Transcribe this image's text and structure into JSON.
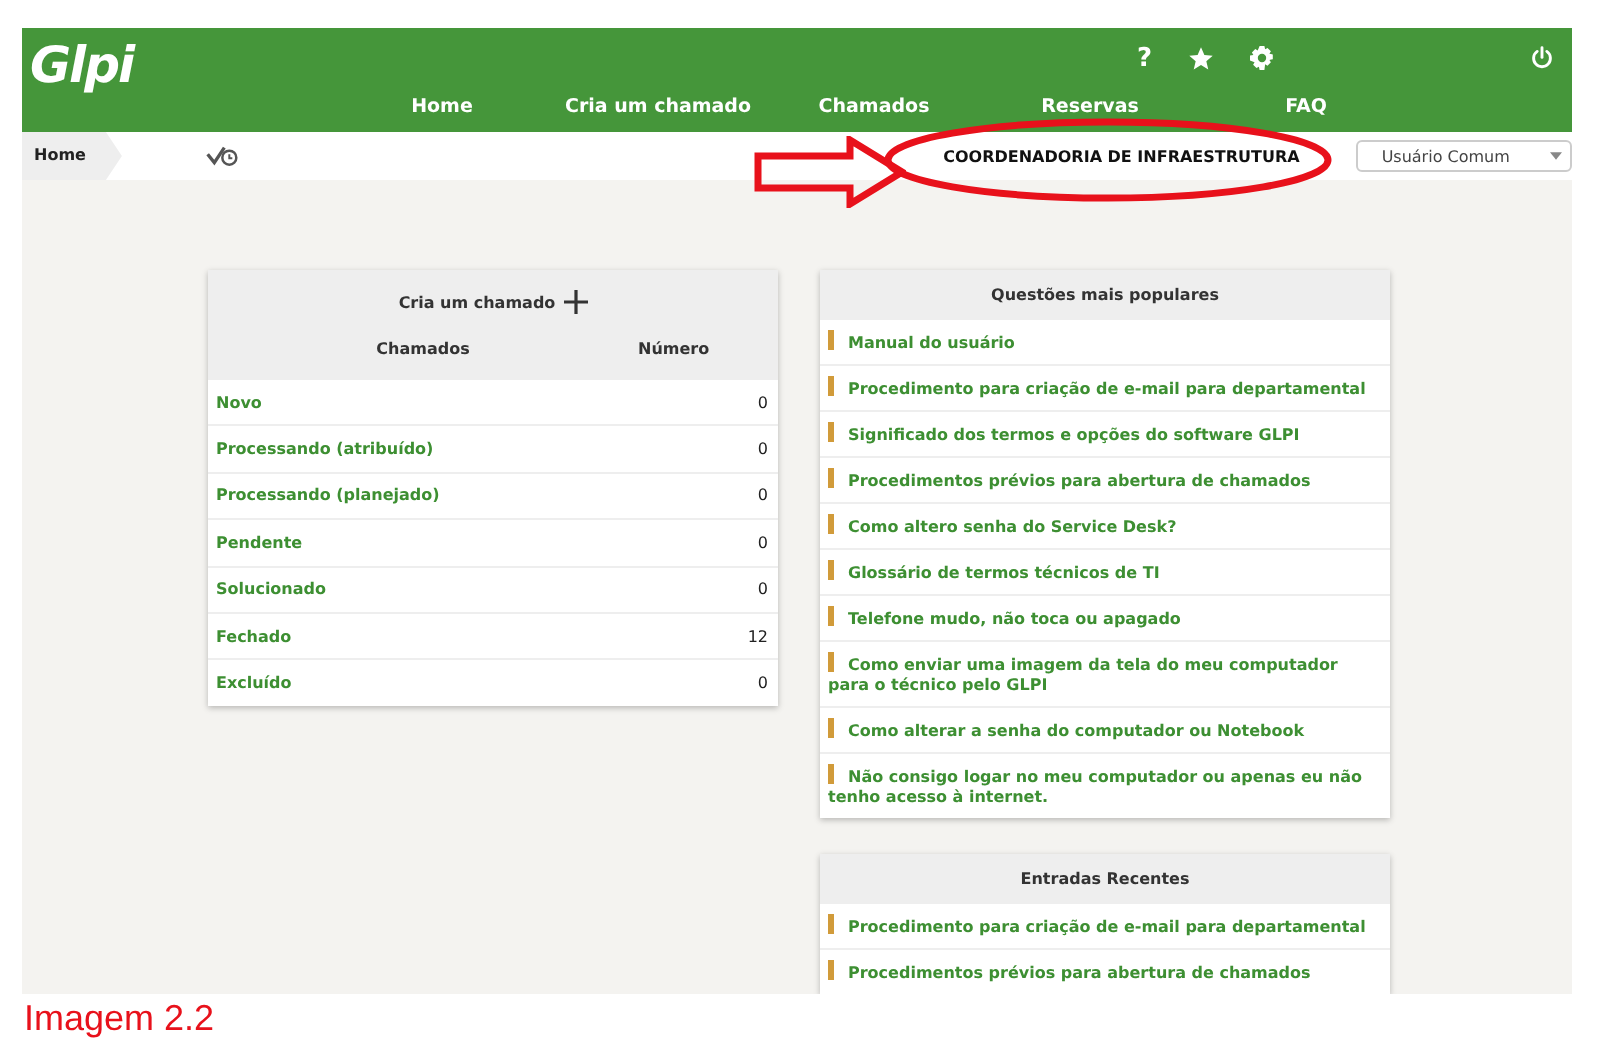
{
  "header": {
    "logo": "Glpi",
    "help": "?",
    "nav": [
      "Home",
      "Cria um chamado",
      "Chamados",
      "Reservas",
      "FAQ"
    ]
  },
  "breadcrumb": {
    "label": "Home",
    "entity": "COORDENADORIA DE INFRAESTRUTURA",
    "profile": "Usuário Comum"
  },
  "tickets": {
    "title": "Cria um chamado",
    "columns": [
      "Chamados",
      "Número"
    ],
    "rows": [
      {
        "status": "Novo",
        "count": "0"
      },
      {
        "status": "Processando (atribuído)",
        "count": "0"
      },
      {
        "status": "Processando (planejado)",
        "count": "0"
      },
      {
        "status": "Pendente",
        "count": "0"
      },
      {
        "status": "Solucionado",
        "count": "0"
      },
      {
        "status": "Fechado",
        "count": "12"
      },
      {
        "status": "Excluído",
        "count": "0"
      }
    ]
  },
  "popular": {
    "title": "Questões mais populares",
    "items": [
      "Manual do usuário",
      "Procedimento para criação de e-mail para departamental",
      "Significado dos termos e opções do software GLPI",
      "Procedimentos prévios para abertura de chamados",
      "Como altero senha do Service Desk?",
      "Glossário de termos técnicos de TI",
      "Telefone mudo, não toca ou apagado",
      "Como enviar uma imagem da tela do meu computador para o técnico pelo GLPI",
      "Como alterar a senha do computador ou Notebook",
      "Não consigo logar no meu computador ou apenas eu não tenho acesso à internet."
    ]
  },
  "recent": {
    "title": "Entradas Recentes",
    "items": [
      "Procedimento para criação de e-mail para departamental",
      "Procedimentos prévios para abertura de chamados"
    ]
  },
  "caption": "Imagem 2.2"
}
